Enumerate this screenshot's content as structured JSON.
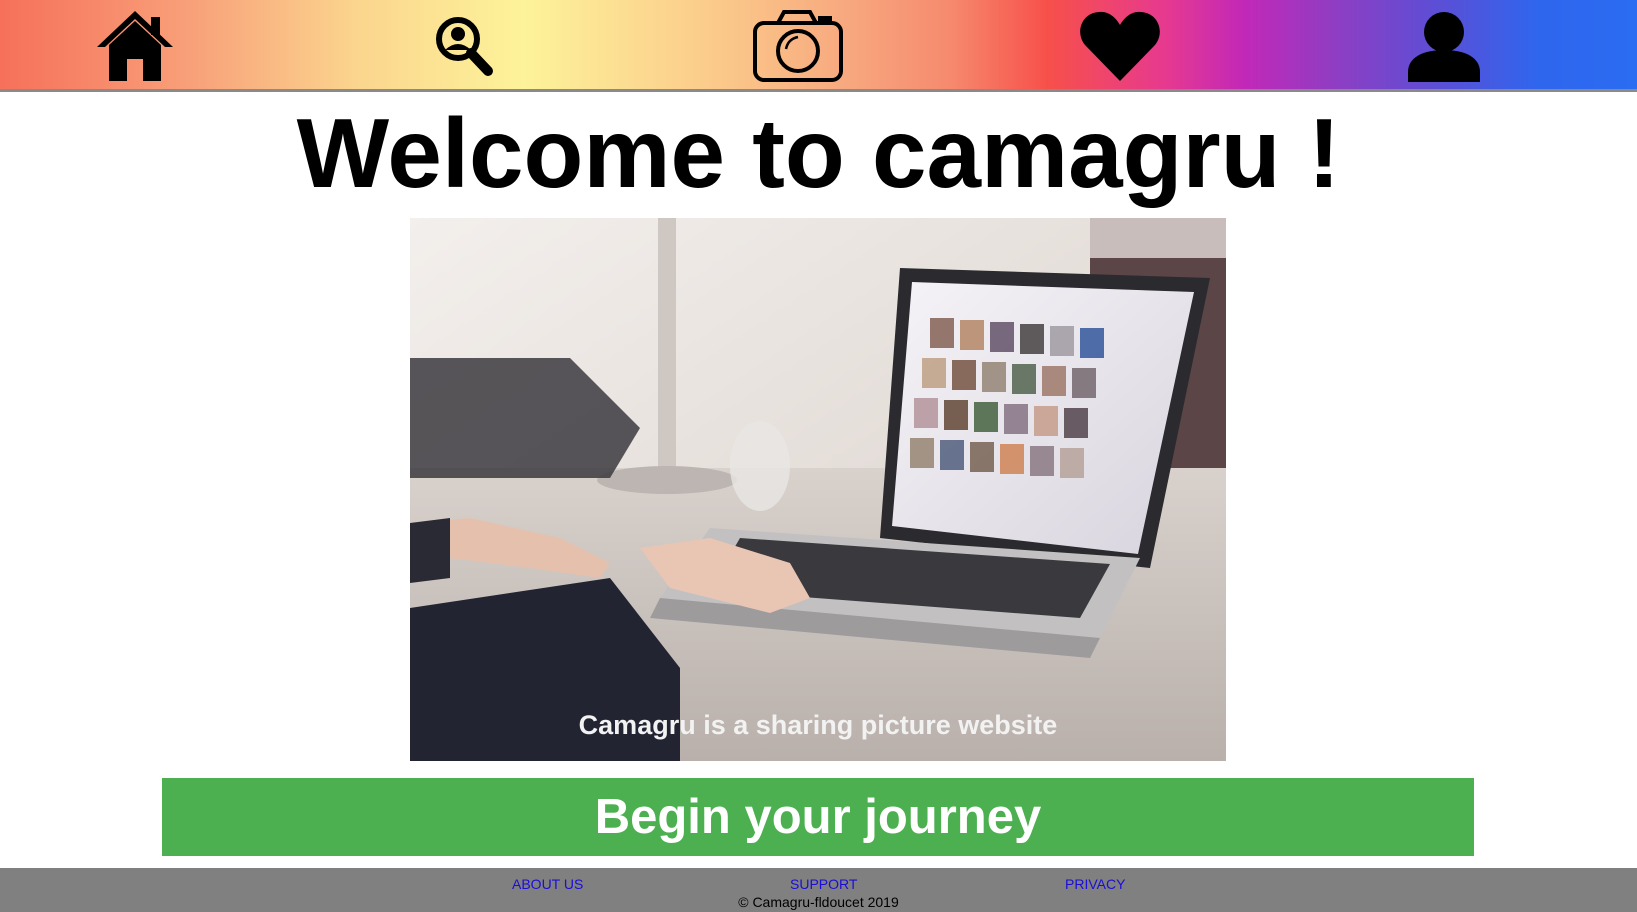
{
  "nav": {
    "items": [
      {
        "icon": "home-icon"
      },
      {
        "icon": "search-icon"
      },
      {
        "icon": "camera-icon"
      },
      {
        "icon": "heart-icon"
      },
      {
        "icon": "user-icon"
      }
    ]
  },
  "main": {
    "title": "Welcome to camagru !",
    "hero_caption": "Camagru is a sharing picture website",
    "cta_label": "Begin your journey"
  },
  "footer": {
    "links": [
      "ABOUT US",
      "SUPPORT",
      "PRIVACY"
    ],
    "copyright": "© Camagru-fldoucet 2019"
  },
  "colors": {
    "cta_background": "#4caf50",
    "footer_background": "#808080",
    "footer_link": "#1a0dd8"
  }
}
